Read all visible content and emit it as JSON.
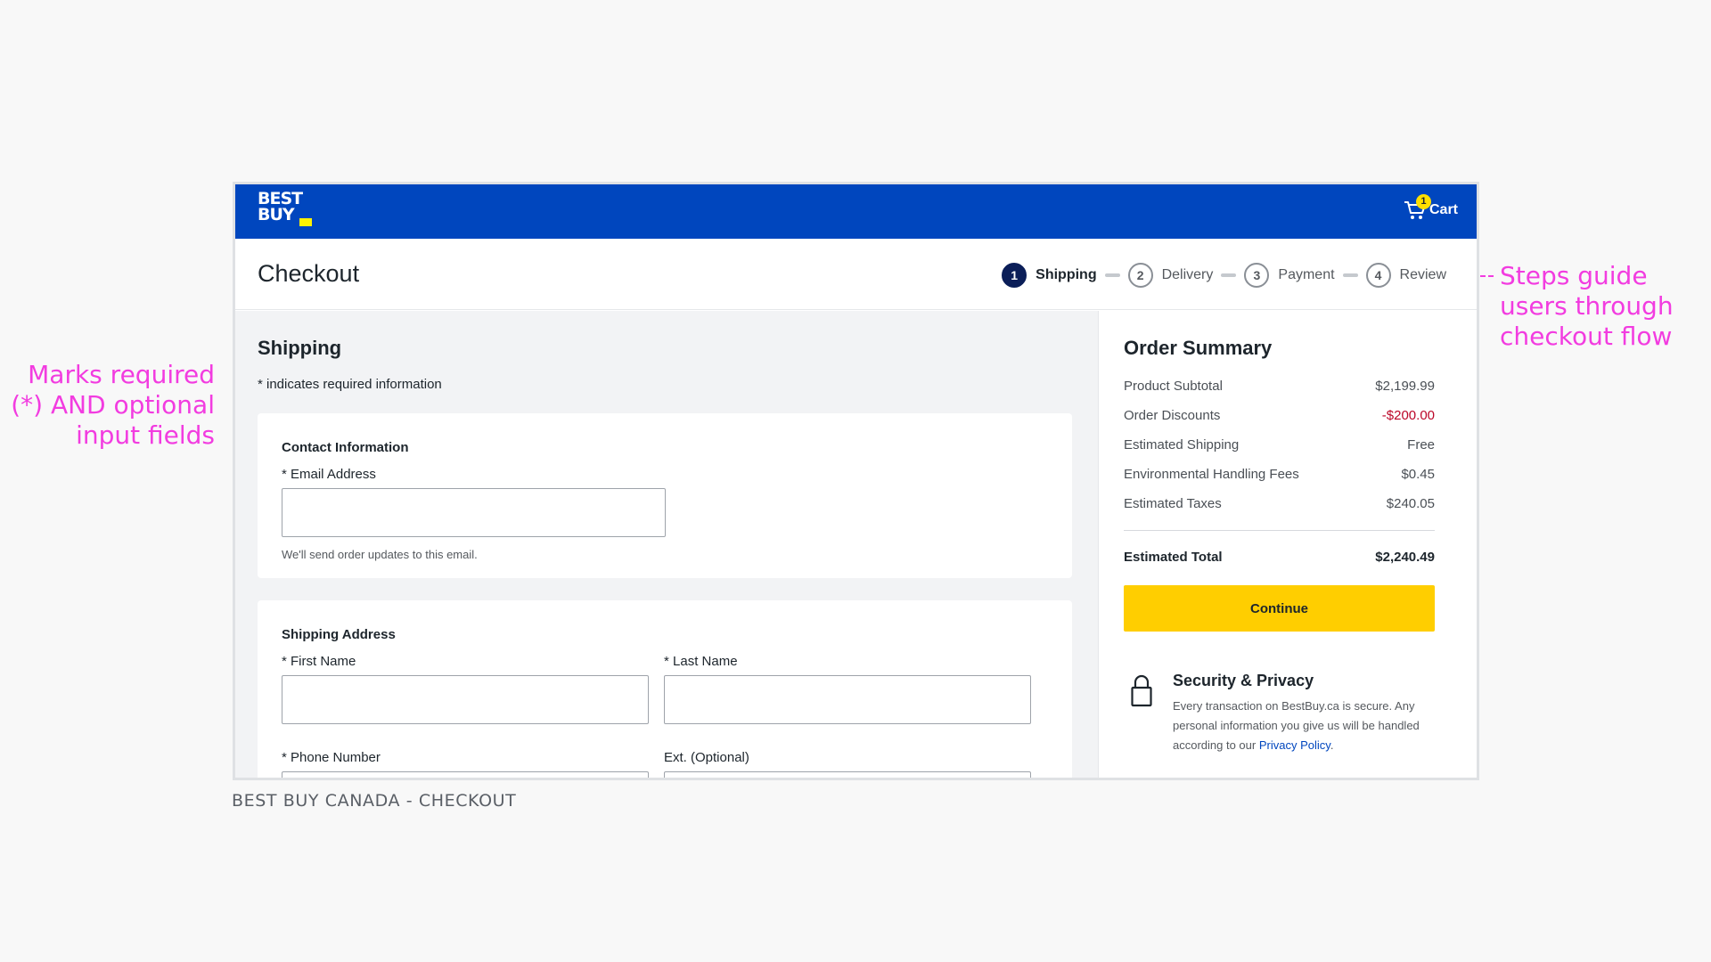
{
  "annotations": {
    "left": "Marks required (*) AND optional input fields",
    "right": "Steps guide users through checkout flow"
  },
  "caption": "BEST BUY CANADA - CHECKOUT",
  "header": {
    "logo_line1": "BEST",
    "logo_line2": "BUY",
    "cart_label": "Cart",
    "cart_count": "1",
    "page_title": "Checkout"
  },
  "steps": [
    {
      "num": "1",
      "label": "Shipping",
      "active": true
    },
    {
      "num": "2",
      "label": "Delivery",
      "active": false
    },
    {
      "num": "3",
      "label": "Payment",
      "active": false
    },
    {
      "num": "4",
      "label": "Review",
      "active": false
    }
  ],
  "shipping": {
    "title": "Shipping",
    "required_note": "* indicates required information",
    "contact": {
      "title": "Contact Information",
      "email_label": "* Email Address",
      "email_value": "",
      "email_helper": "We'll send order updates to this email."
    },
    "address": {
      "title": "Shipping Address",
      "first_name_label": "* First Name",
      "last_name_label": "* Last Name",
      "phone_label": "* Phone Number",
      "ext_label": "Ext. (Optional)"
    }
  },
  "summary": {
    "title": "Order Summary",
    "rows": [
      {
        "label": "Product Subtotal",
        "value": "$2,199.99"
      },
      {
        "label": "Order Discounts",
        "value": "-$200.00"
      },
      {
        "label": "Estimated Shipping",
        "value": "Free"
      },
      {
        "label": "Environmental Handling Fees",
        "value": "$0.45"
      },
      {
        "label": "Estimated Taxes",
        "value": "$240.05"
      }
    ],
    "total_label": "Estimated Total",
    "total_value": "$2,240.49",
    "continue_label": "Continue",
    "security_title": "Security & Privacy",
    "security_text": "Every transaction on BestBuy.ca is secure. Any personal information you give us will be handled according to our",
    "privacy_link": "Privacy Policy",
    "security_end": "."
  },
  "colors": {
    "brand_blue": "#0046be",
    "brand_yellow": "#ffce00",
    "annotation_pink": "#f23ce0",
    "discount_red": "#bb0628"
  }
}
